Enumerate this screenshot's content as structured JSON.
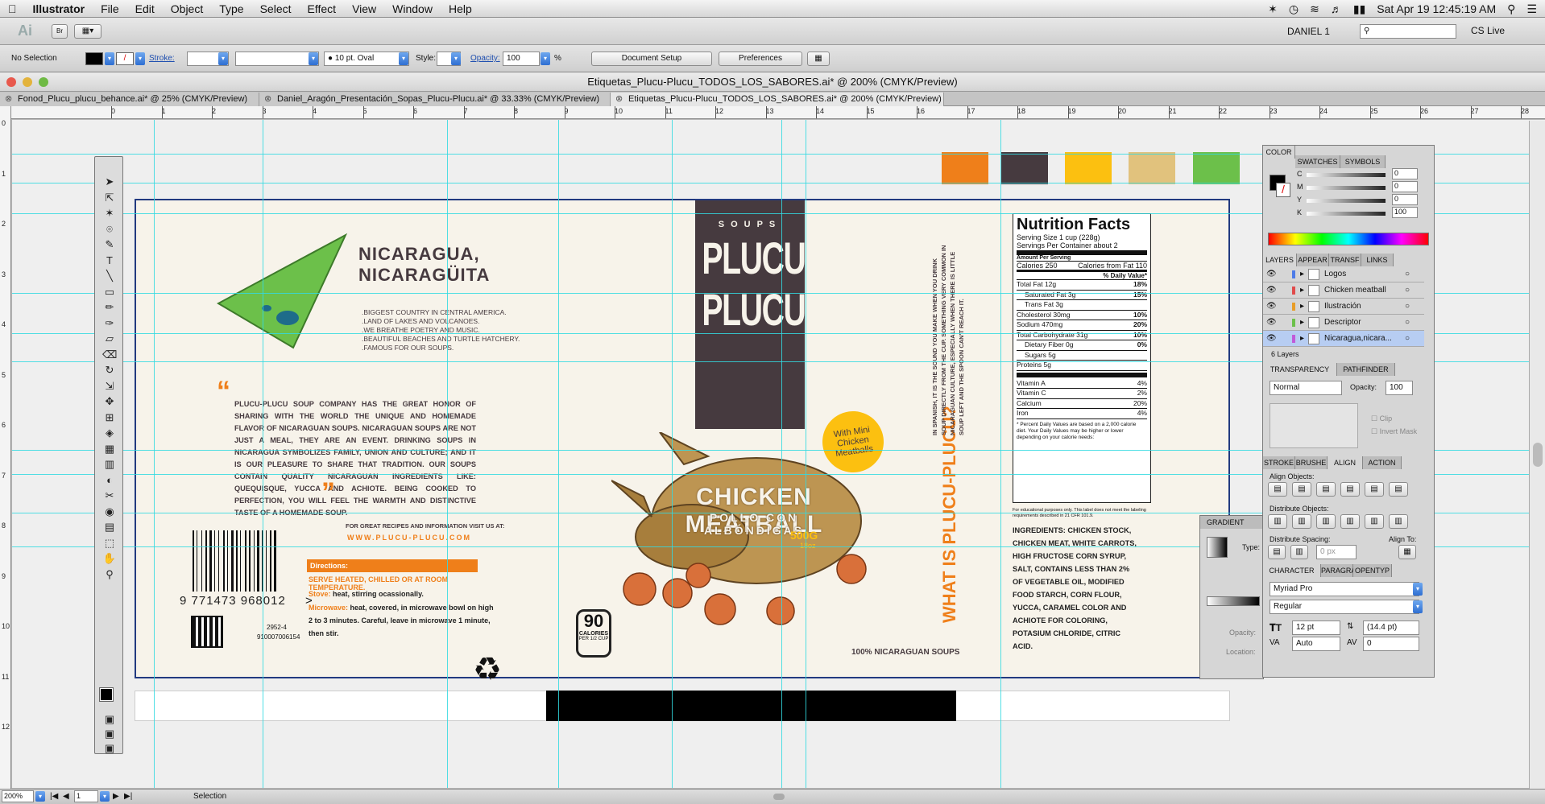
{
  "menubar": {
    "app": "Illustrator",
    "items": [
      "File",
      "Edit",
      "Object",
      "Type",
      "Select",
      "Effect",
      "View",
      "Window",
      "Help"
    ],
    "datetime": "Sat Apr 19  12:45:19 AM"
  },
  "appbar": {
    "ai": "Ai",
    "br": "Br",
    "user": "DANIEL 1",
    "cslive": "CS Live"
  },
  "control": {
    "selection": "No Selection",
    "stroke_label": "Stroke:",
    "brush": "10 pt. Oval",
    "style_label": "Style:",
    "opacity_label": "Opacity:",
    "opacity": "100",
    "percent": "%",
    "doc_setup": "Document Setup",
    "preferences": "Preferences"
  },
  "window": {
    "title": "Etiquetas_Plucu-Plucu_TODOS_LOS_SABORES.ai* @ 200% (CMYK/Preview)"
  },
  "tabs": [
    "Fonod_Plucu_plucu_behance.ai* @ 25% (CMYK/Preview)",
    "Daniel_Aragón_Presentación_Sopas_Plucu-Plucu.ai* @ 33.33% (CMYK/Preview)",
    "Etiquetas_Plucu-Plucu_TODOS_LOS_SABORES.ai* @ 200% (CMYK/Preview)"
  ],
  "ruler": [
    "0",
    "1",
    "2",
    "3",
    "4",
    "5",
    "6",
    "7",
    "8",
    "9",
    "10",
    "11",
    "12",
    "13",
    "14",
    "15",
    "16",
    "17",
    "18",
    "19",
    "20",
    "21",
    "22",
    "23",
    "24",
    "25",
    "26",
    "27",
    "28"
  ],
  "swatches": [
    "#ef7f1a",
    "#463a3f",
    "#fcc010",
    "#e1c27d",
    "#6cc04a"
  ],
  "label": {
    "region_title": "NICARAGUA,\nNICARAGÜITA",
    "region_facts": ".BIGGEST COUNTRY IN CENTRAL AMERICA.\n.LAND OF LAKES AND VOLCANOES.\n.WE BREATHE POETRY AND MUSIC.\n.BEAUTIFUL BEACHES AND TURTLE HATCHERY.\n.FAMOUS FOR OUR SOUPS.",
    "story": "PLUCU-PLUCU SOUP COMPANY HAS THE GREAT HONOR OF SHARING WITH THE WORLD THE UNIQUE AND HOMEMADE FLAVOR OF NICARAGUAN SOUPS. NICARAGUAN SOUPS ARE NOT JUST A MEAL, THEY ARE AN EVENT. DRINKING SOUPS IN NICARAGUA SYMBOLIZES FAMILY, UNION AND CULTURE; AND IT IS OUR PLEASURE TO SHARE THAT TRADITION. OUR SOUPS CONTAIN QUALITY NICARAGUAN INGREDIENTS LIKE: QUEQUISQUE, YUCCA AND ACHIOTE. BEING COOKED TO PERFECTION, YOU WILL FEEL THE WARMTH AND DISTINCTIVE TASTE OF A HOMEMADE SOUP.",
    "recipes": "FOR GREAT RECIPES AND INFORMATION VISIT US AT:",
    "url": "WWW.PLUCU-PLUCU.COM",
    "directions_title": "Directions:",
    "directions_serve": "SERVE HEATED, CHILLED OR AT ROOM TEMPERATURE.",
    "stove_label": "Stove:",
    "stove": "heat, stirring ocassionally.",
    "micro_label": "Microwave:",
    "micro": "heat, covered, in microwave bowl on high 2 to 3 minutes. Careful, leave in microwave 1 minute, then stir.",
    "barcode": "9 771473 968012",
    "barcode_end": ">",
    "code1": "2952-4",
    "code2": "910007006154",
    "cal_num": "90",
    "cal_word": "CALORIES",
    "cal_per": "PER 1/2 CUP",
    "brand_top": "SOUPS",
    "brand1": "PLUCU-",
    "brand2": "PLUCU",
    "badge": "With Mini Chicken Meatballs",
    "flavor": "CHICKEN MEATBALL",
    "flavor_es": "POLLO CON ALBÓNDIGAS",
    "weight": "500G",
    "weight2": "18oz",
    "origin": "100% NICARAGUAN SOUPS",
    "side_q": "WHAT IS PLUCU-PLUCU?",
    "side_text": "IN SPANISH, IT IS THE SOUND YOU MAKE WHEN YOU DRINK SOUP DIRECTLY FROM THE CUP. SOMETHING VERY COMMON IN NICARAGUAN CULTURE, ESPECIALLY WHEN THERE IS LITTLE SOUP LEFT AND THE SPOON CAN'T REACH IT.",
    "ingredients": "INGREDIENTS: CHICKEN STOCK, CHICKEN MEAT, WHITE CARROTS, HIGH FRUCTOSE CORN SYRUP, SALT, CONTAINS LESS THAN 2% OF VEGETABLE OIL, MODIFIED FOOD STARCH, CORN FLOUR, YUCCA, CARAMEL COLOR AND ACHIOTE FOR COLORING, POTASIUM CHLORIDE, CITRIC ACID."
  },
  "nutrition": {
    "title": "Nutrition Facts",
    "serving": "Serving Size 1 cup (228g)",
    "servings": "Servings Per Container about 2",
    "amount": "Amount Per Serving",
    "calories": "Calories 250",
    "cal_fat": "Calories from Fat 110",
    "dv": "% Daily Value*",
    "rows": [
      [
        "Total Fat 12g",
        "18%"
      ],
      [
        "Saturated Fat 3g",
        "15%"
      ],
      [
        "Trans Fat 3g",
        ""
      ],
      [
        "Cholesterol 30mg",
        "10%"
      ],
      [
        "Sodium 470mg",
        "20%"
      ],
      [
        "Total Carbohydrate 31g",
        "10%"
      ],
      [
        "Dietary Fiber 0g",
        "0%"
      ],
      [
        "Sugars 5g",
        ""
      ],
      [
        "Proteins 5g",
        ""
      ]
    ],
    "vitamins": [
      [
        "Vitamin A",
        "4%"
      ],
      [
        "Vitamin C",
        "2%"
      ],
      [
        "Calcium",
        "20%"
      ],
      [
        "Iron",
        "4%"
      ]
    ],
    "footnote": "* Percent Daily Values are based on a 2,000 calorie diet. Your Daily Values may be higher or lower depending on your calorie needs:",
    "edu": "For educational purposes only. This label does not meet the labeling requirements described in 21 CFR 101.9."
  },
  "panels": {
    "color_tabs": [
      "COLOR",
      "SWATCHES",
      "SYMBOLS"
    ],
    "cmyk": [
      [
        "C",
        "0"
      ],
      [
        "M",
        "0"
      ],
      [
        "Y",
        "0"
      ],
      [
        "K",
        "100"
      ]
    ],
    "layer_tabs": [
      "LAYERS",
      "APPEAR",
      "TRANSF",
      "LINKS"
    ],
    "layers": [
      "Logos",
      "Chicken meatball",
      "Ilustración",
      "Descriptor",
      "Nicaragua,nicara..."
    ],
    "layers_count": "6 Layers",
    "transp_tabs": [
      "TRANSPARENCY",
      "PATHFINDER"
    ],
    "blend": "Normal",
    "opacity_label": "Opacity:",
    "opacity": "100",
    "clip": "Clip",
    "invert": "Invert Mask",
    "align_tabs": [
      "STROKE",
      "BRUSHE",
      "ALIGN",
      "ACTION"
    ],
    "align_objects": "Align Objects:",
    "distribute_objects": "Distribute Objects:",
    "distribute_spacing": "Distribute Spacing:",
    "align_to": "Align To:",
    "spacing": "0 px",
    "gradient": "GRADIENT",
    "grad_type": "Type:",
    "grad_opacity": "Opacity:",
    "grad_location": "Location:",
    "char_tabs": [
      "CHARACTER",
      "PARAGRA",
      "OPENTYP"
    ],
    "font": "Myriad Pro",
    "style": "Regular",
    "size": "12 pt",
    "leading": "(14.4 pt)",
    "kerning": "Auto",
    "tracking": "0"
  },
  "status": {
    "zoom": "200%",
    "page": "1",
    "mode": "Selection"
  }
}
